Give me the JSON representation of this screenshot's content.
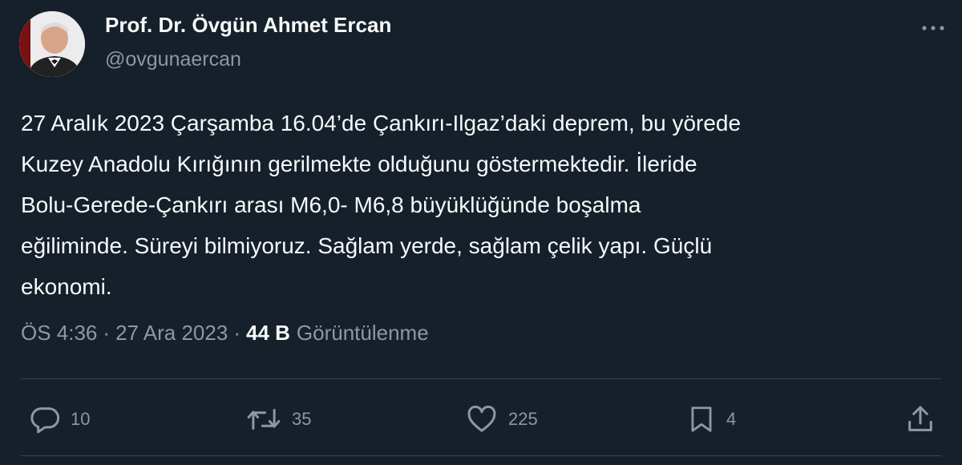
{
  "author": {
    "name": "Prof. Dr. Övgün Ahmet Ercan",
    "handle": "@ovgunaercan",
    "avatar_icon": "profile-photo"
  },
  "tweet": {
    "text": "27 Aralık 2023 Çarşamba 16.04’de Çankırı-Ilgaz’daki deprem, bu yörede\nKuzey Anadolu Kırığının gerilmekte olduğunu göstermektedir. İleride\nBolu-Gerede-Çankırı arası M6,0- M6,8 büyüklüğünde boşalma\neğiliminde. Süreyi bilmiyoruz. Sağlam yerde, sağlam çelik yapı. Güçlü\nekonomi."
  },
  "meta": {
    "time": "ÖS 4:36",
    "separator": "·",
    "date": "27 Ara 2023",
    "views_count": "44 B",
    "views_label": "Görüntülenme"
  },
  "actions": {
    "replies": "10",
    "retweets": "35",
    "likes": "225",
    "bookmarks": "4"
  },
  "icons": [
    "more-icon",
    "reply-icon",
    "retweet-icon",
    "like-icon",
    "bookmark-icon",
    "share-icon"
  ],
  "colors": {
    "background": "#15202b",
    "text": "#f7f9f9",
    "secondary": "#8b98a5",
    "divider": "#38444d"
  }
}
